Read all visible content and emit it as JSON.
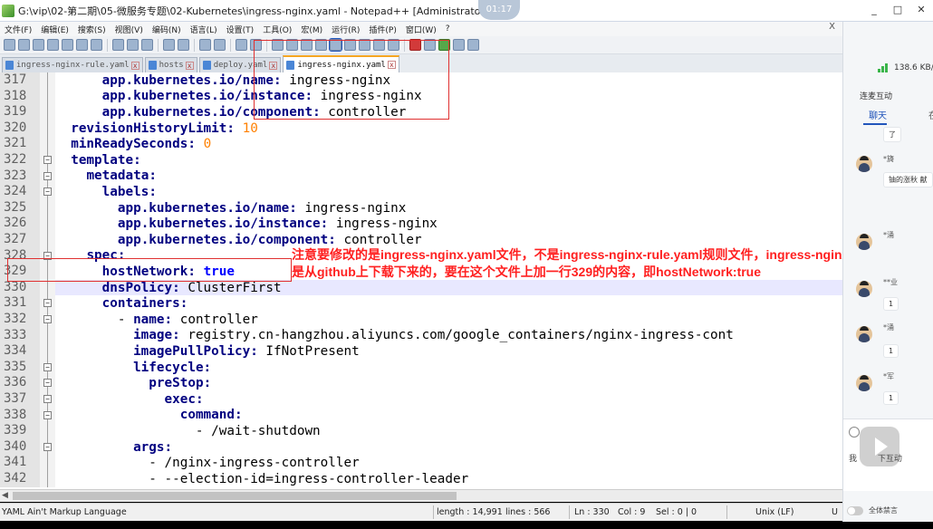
{
  "window": {
    "title": "G:\\vip\\02-第二期\\05-微服务专题\\02-Kubernetes\\ingress-nginx.yaml - Notepad++ [Administrator]",
    "clock": "01:17",
    "controls": [
      "_",
      "□",
      "✕"
    ]
  },
  "menu": {
    "items": [
      "文件(F)",
      "编辑(E)",
      "搜索(S)",
      "视图(V)",
      "编码(N)",
      "语言(L)",
      "设置(T)",
      "工具(O)",
      "宏(M)",
      "运行(R)",
      "插件(P)",
      "窗口(W)",
      "?"
    ],
    "close_x": "X"
  },
  "tabs": [
    {
      "label": "ingress-nginx-rule.yaml",
      "active": false
    },
    {
      "label": "hosts",
      "active": false
    },
    {
      "label": "deploy.yaml",
      "active": false
    },
    {
      "label": "ingress-nginx.yaml",
      "active": true
    }
  ],
  "editor": {
    "current_line": 330,
    "lines": [
      {
        "num": "317",
        "indent": "      ",
        "key": "app.kubernetes.io/name",
        "sep": ": ",
        "value": "ingress-nginx",
        "vtype": "v",
        "fold": "bar"
      },
      {
        "num": "318",
        "indent": "      ",
        "key": "app.kubernetes.io/instance",
        "sep": ": ",
        "value": "ingress-nginx",
        "vtype": "v",
        "fold": "bar"
      },
      {
        "num": "319",
        "indent": "      ",
        "key": "app.kubernetes.io/component",
        "sep": ": ",
        "value": "controller",
        "vtype": "v",
        "fold": "bar"
      },
      {
        "num": "320",
        "indent": "  ",
        "key": "revisionHistoryLimit",
        "sep": ": ",
        "value": "10",
        "vtype": "n",
        "fold": "bar"
      },
      {
        "num": "321",
        "indent": "  ",
        "key": "minReadySeconds",
        "sep": ": ",
        "value": "0",
        "vtype": "n",
        "fold": "bar"
      },
      {
        "num": "322",
        "indent": "  ",
        "key": "template",
        "sep": ":",
        "value": "",
        "vtype": "v",
        "fold": "box"
      },
      {
        "num": "323",
        "indent": "    ",
        "key": "metadata",
        "sep": ":",
        "value": "",
        "vtype": "v",
        "fold": "box"
      },
      {
        "num": "324",
        "indent": "      ",
        "key": "labels",
        "sep": ":",
        "value": "",
        "vtype": "v",
        "fold": "box"
      },
      {
        "num": "325",
        "indent": "        ",
        "key": "app.kubernetes.io/name",
        "sep": ": ",
        "value": "ingress-nginx",
        "vtype": "v",
        "fold": "bar"
      },
      {
        "num": "326",
        "indent": "        ",
        "key": "app.kubernetes.io/instance",
        "sep": ": ",
        "value": "ingress-nginx",
        "vtype": "v",
        "fold": "bar"
      },
      {
        "num": "327",
        "indent": "        ",
        "key": "app.kubernetes.io/component",
        "sep": ": ",
        "value": "controller",
        "vtype": "v",
        "fold": "bar"
      },
      {
        "num": "328",
        "indent": "    ",
        "key": "spec",
        "sep": ":",
        "value": "",
        "vtype": "v",
        "fold": "box"
      },
      {
        "num": "329",
        "indent": "      ",
        "key": "hostNetwork",
        "sep": ": ",
        "value": "true",
        "vtype": "b",
        "fold": "bar"
      },
      {
        "num": "330",
        "indent": "      ",
        "key": "dnsPolicy",
        "sep": ": ",
        "value": "ClusterFirst",
        "vtype": "v",
        "fold": "bar"
      },
      {
        "num": "331",
        "indent": "      ",
        "key": "containers",
        "sep": ":",
        "value": "",
        "vtype": "v",
        "fold": "box"
      },
      {
        "num": "332",
        "indent": "        - ",
        "key": "name",
        "sep": ": ",
        "value": "controller",
        "vtype": "v",
        "fold": "box"
      },
      {
        "num": "333",
        "indent": "          ",
        "key": "image",
        "sep": ": ",
        "value": "registry.cn-hangzhou.aliyuncs.com/google_containers/nginx-ingress-cont",
        "vtype": "v",
        "fold": "bar"
      },
      {
        "num": "334",
        "indent": "          ",
        "key": "imagePullPolicy",
        "sep": ": ",
        "value": "IfNotPresent",
        "vtype": "v",
        "fold": "bar"
      },
      {
        "num": "335",
        "indent": "          ",
        "key": "lifecycle",
        "sep": ":",
        "value": "",
        "vtype": "v",
        "fold": "box"
      },
      {
        "num": "336",
        "indent": "            ",
        "key": "preStop",
        "sep": ":",
        "value": "",
        "vtype": "v",
        "fold": "box"
      },
      {
        "num": "337",
        "indent": "              ",
        "key": "exec",
        "sep": ":",
        "value": "",
        "vtype": "v",
        "fold": "box"
      },
      {
        "num": "338",
        "indent": "                ",
        "key": "command",
        "sep": ":",
        "value": "",
        "vtype": "v",
        "fold": "box"
      },
      {
        "num": "339",
        "indent": "                  - ",
        "key": "",
        "sep": "",
        "value": "/wait-shutdown",
        "vtype": "v",
        "fold": "bar"
      },
      {
        "num": "340",
        "indent": "          ",
        "key": "args",
        "sep": ":",
        "value": "",
        "vtype": "v",
        "fold": "box"
      },
      {
        "num": "341",
        "indent": "            - ",
        "key": "",
        "sep": "",
        "value": "/nginx-ingress-controller",
        "vtype": "v",
        "fold": "bar"
      },
      {
        "num": "342",
        "indent": "            - ",
        "key": "",
        "sep": "",
        "value": "--election-id=ingress-controller-leader",
        "vtype": "v",
        "fold": "bar"
      }
    ]
  },
  "annotation": {
    "line1": "注意要修改的是ingress-nginx.yaml文件，不是ingress-nginx-rule.yaml规则文件，ingress-nginx.yaml",
    "line2": "是从github上下载下来的，要在这个文件上加一行329的内容，即hostNetwork:true",
    "color": "#ff2020"
  },
  "statusbar": {
    "language": "YAML Ain't Markup Language",
    "length": "length : 14,991",
    "lines": "lines : 566",
    "ln": "Ln : 330",
    "col": "Col : 9",
    "sel": "Sel : 0 | 0",
    "eol": "Unix (LF)",
    "enc": "U"
  },
  "side_panel": {
    "network": "138.6 KB/",
    "title": "连麦互动",
    "tab_chat": "聊天",
    "tab_more": "在",
    "messages": [
      {
        "name": "",
        "text": "了"
      },
      {
        "name": "*旖",
        "text": "铀的涨秋 献"
      },
      {
        "name": "*涌",
        "text": ""
      },
      {
        "name": "**业",
        "text": "1"
      },
      {
        "name": "*涌",
        "text": "1"
      },
      {
        "name": "*军",
        "text": "1"
      }
    ],
    "input_hint": "我",
    "input_hint_tail": "下互动",
    "mute_label": "全体禁言"
  }
}
